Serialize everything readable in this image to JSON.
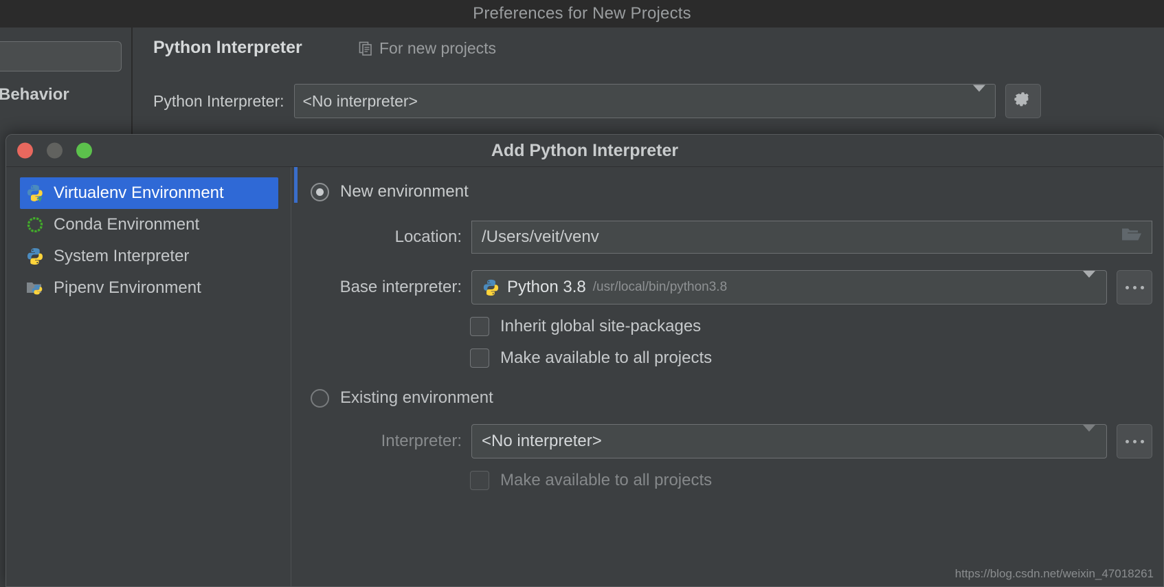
{
  "preferences": {
    "window_title": "Preferences for New Projects",
    "sidebar": {
      "search_placeholder": "",
      "visible_item": "Behavior"
    },
    "heading": "Python Interpreter",
    "scope_label": "For new projects",
    "scope_icon": "copy-icon",
    "interpreter_row": {
      "label": "Python Interpreter:",
      "value": "<No interpreter>"
    },
    "gear_icon": "gear-icon"
  },
  "dialog": {
    "title": "Add Python Interpreter",
    "traffic_lights": {
      "close": "close-window-button",
      "minimize": "minimize-window-button",
      "zoom": "zoom-window-button",
      "close_color": "#e8685e",
      "minimize_color": "#61625f",
      "zoom_color": "#5cc14c"
    },
    "env_types": [
      {
        "label": "Virtualenv Environment",
        "icon": "python-virtualenv-icon",
        "selected": true
      },
      {
        "label": "Conda Environment",
        "icon": "conda-icon",
        "selected": false
      },
      {
        "label": "System Interpreter",
        "icon": "python-icon",
        "selected": false
      },
      {
        "label": "Pipenv Environment",
        "icon": "pipenv-folder-icon",
        "selected": false
      }
    ],
    "selection_color": "#2f69d6",
    "new_environment": {
      "radio_label": "New environment",
      "selected": true,
      "location": {
        "label": "Location:",
        "value": "/Users/veit/venv",
        "browse_icon": "folder-icon"
      },
      "base_interpreter": {
        "label": "Base interpreter:",
        "value": "Python 3.8",
        "value_path": "/usr/local/bin/python3.8",
        "icon": "python-icon",
        "browse_button": "..."
      },
      "checkboxes": [
        {
          "label": "Inherit global site-packages",
          "checked": false,
          "enabled": true
        },
        {
          "label": "Make available to all projects",
          "checked": false,
          "enabled": true
        }
      ]
    },
    "existing_environment": {
      "radio_label": "Existing environment",
      "selected": false,
      "interpreter": {
        "label": "Interpreter:",
        "value": "<No interpreter>",
        "browse_button": "..."
      },
      "checkboxes": [
        {
          "label": "Make available to all projects",
          "checked": false,
          "enabled": false
        }
      ]
    }
  },
  "watermark": "https://blog.csdn.net/weixin_47018261"
}
